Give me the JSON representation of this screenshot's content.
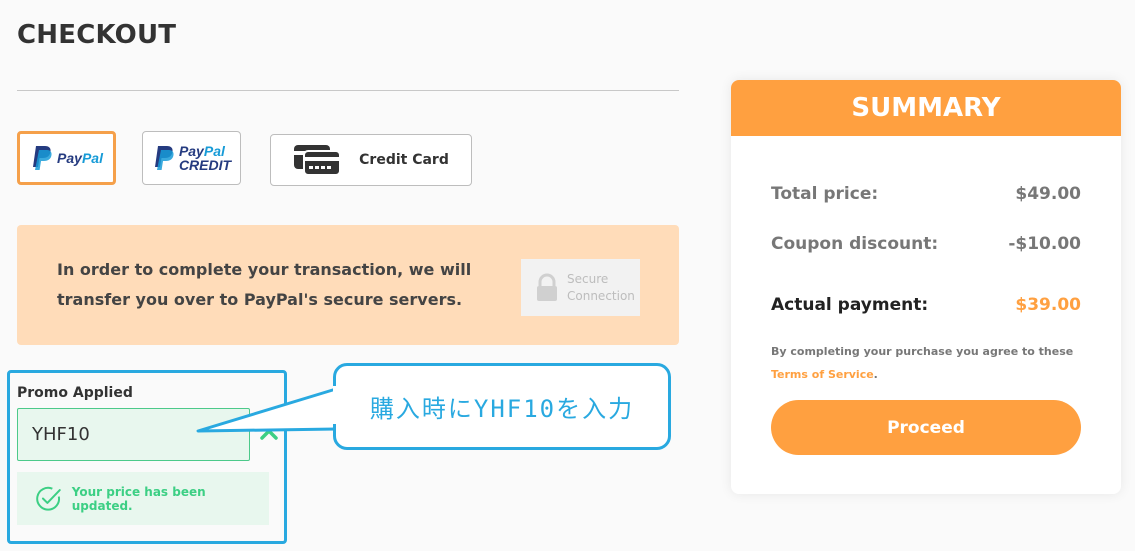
{
  "page": {
    "title": "CHECKOUT"
  },
  "payment_options": [
    {
      "label": "PayPal",
      "part1": "Pay",
      "part2": "Pal",
      "selected": true
    },
    {
      "label": "PayPal Credit",
      "part1": "Pay",
      "part2": "Pal",
      "part3": "CREDIT",
      "selected": false
    },
    {
      "label": "Credit Card",
      "selected": false
    }
  ],
  "notice": {
    "text": "In order to complete your transaction, we will transfer you over to PayPal's secure servers.",
    "badge_line1": "Secure",
    "badge_line2": "Connection"
  },
  "promo": {
    "label": "Promo Applied",
    "value": "YHF10",
    "message": "Your price has been updated."
  },
  "callout": {
    "text": "購入時にYHF10を入力"
  },
  "summary": {
    "title": "SUMMARY",
    "total_label": "Total price:",
    "total_value": "$49.00",
    "coupon_label": "Coupon discount:",
    "coupon_value": "-$10.00",
    "actual_label": "Actual payment:",
    "actual_value": "$39.00",
    "agree_text": "By completing your purchase you agree to these",
    "terms_link": "Terms of Service",
    "terms_suffix": ".",
    "proceed_label": "Proceed"
  },
  "colors": {
    "accent_orange": "#ffa040",
    "highlight_blue": "#29a9e0",
    "success_green": "#3ccf84",
    "paypal_dark": "#253b80",
    "paypal_light": "#179bd7"
  },
  "icons": [
    "paypal-logo-icon",
    "credit-card-icon",
    "lock-icon",
    "close-icon",
    "check-circle-icon"
  ]
}
